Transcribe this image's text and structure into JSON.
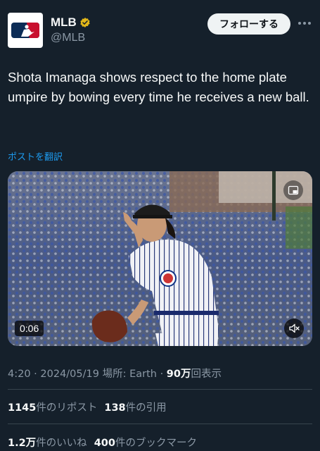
{
  "account": {
    "name": "MLB",
    "handle": "@MLB",
    "logo_text": "MLB",
    "verified_color": "#e2b719"
  },
  "actions": {
    "follow_label": "フォローする"
  },
  "tweet": {
    "text": "Shota Imanaga shows respect to the home plate umpire by bowing every time he receives a new ball.",
    "translate_label": "ポストを翻訳"
  },
  "media": {
    "duration": "0:06",
    "icons": [
      "picture-in-picture-icon",
      "muted-speaker-icon"
    ]
  },
  "meta": {
    "time": "4:20",
    "sep1": " · ",
    "date": "2024/05/19",
    "location_label": " 場所: ",
    "location": "Earth",
    "sep2": " · ",
    "views": "90万",
    "views_label": "回表示"
  },
  "stats": {
    "reposts": "1145",
    "reposts_label": "件のリポスト",
    "quotes": "138",
    "quotes_label": "件の引用",
    "likes": "1.2万",
    "likes_label": "件のいいね",
    "bookmarks": "400",
    "bookmarks_label": "件のブックマーク"
  },
  "colors": {
    "background": "#15202b",
    "accent": "#1d9bf0",
    "text": "#f7f9f9",
    "secondary": "#8b98a5",
    "border": "#38444d"
  }
}
